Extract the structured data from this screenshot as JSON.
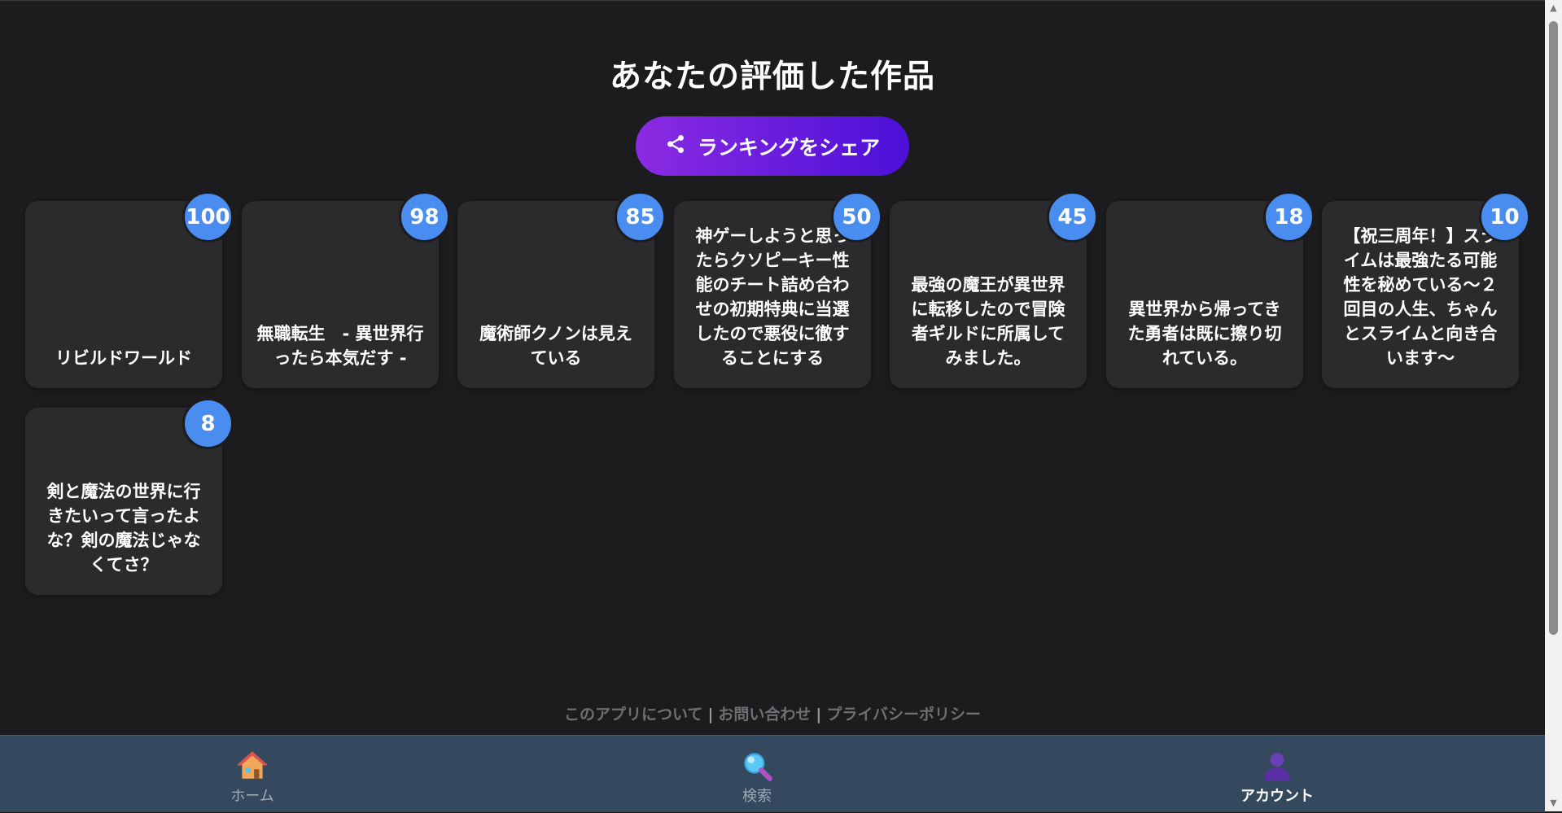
{
  "page": {
    "title": "あなたの評価した作品",
    "share_button_label": "ランキングをシェア",
    "share_icon": "share-icon"
  },
  "works": [
    {
      "score": "100",
      "title": "リビルドワールド"
    },
    {
      "score": "98",
      "title": "無職転生　- 異世界行ったら本気だす -"
    },
    {
      "score": "85",
      "title": "魔術師クノンは見えている"
    },
    {
      "score": "50",
      "title": "神ゲーしようと思ったらクソピーキー性能のチート詰め合わせの初期特典に当選したので悪役に徹することにする"
    },
    {
      "score": "45",
      "title": "最強の魔王が異世界に転移したので冒険者ギルドに所属してみました。"
    },
    {
      "score": "18",
      "title": "異世界から帰ってきた勇者は既に擦り切れている。"
    },
    {
      "score": "10",
      "title": "【祝三周年！】スライムは最強たる可能性を秘めている〜２回目の人生、ちゃんとスライムと向き合います〜"
    },
    {
      "score": "8",
      "title": "剣と魔法の世界に行きたいって言ったよな？剣の魔法じゃなくてさ？"
    }
  ],
  "footer": {
    "about": "このアプリについて",
    "separator": "|",
    "contact": "お問い合わせ",
    "privacy": "プライバシーポリシー"
  },
  "nav": {
    "home_label": "ホーム",
    "home_icon": "house-icon",
    "search_label": "検索",
    "search_icon": "magnifier-icon",
    "account_label": "アカウント",
    "account_icon": "user-icon",
    "active": "account"
  },
  "colors": {
    "background": "#1c1c1e",
    "card": "#2b2b2e",
    "badge": "#4a8df0",
    "share_gradient_start": "#8b2be2",
    "share_gradient_end": "#4b10d8",
    "nav_background": "#34495e"
  }
}
